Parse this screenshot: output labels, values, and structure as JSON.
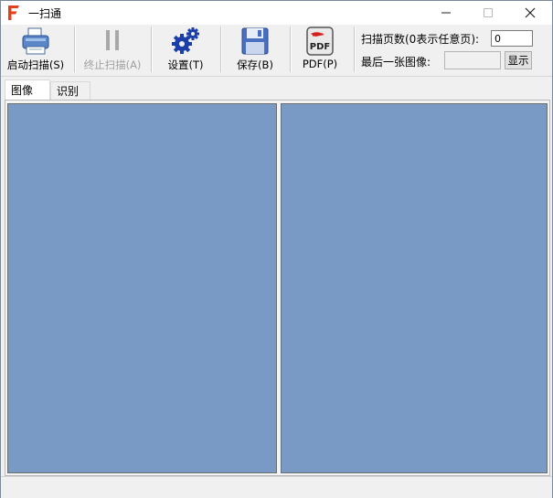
{
  "window": {
    "title": "一扫通",
    "controls": {
      "minimize": "—",
      "maximize": "☐",
      "close": "✕"
    }
  },
  "toolbar": {
    "start_scan": "启动扫描(S)",
    "stop_scan": "终止扫描(A)",
    "settings": "设置(T)",
    "save": "保存(B)",
    "pdf": "PDF(P)",
    "pages_label": "扫描页数(0表示任意页):",
    "pages_value": "0",
    "last_image_label": "最后一张图像:",
    "show_button": "显示"
  },
  "icons": {
    "pdf_icon_text": "PDF"
  },
  "tabs": [
    {
      "label": "图像",
      "active": true
    },
    {
      "label": "识别",
      "active": false
    }
  ],
  "colors": {
    "panel": "#7a9ac6",
    "accent_red": "#e0401a",
    "icon_blue": "#1a3fa8"
  }
}
